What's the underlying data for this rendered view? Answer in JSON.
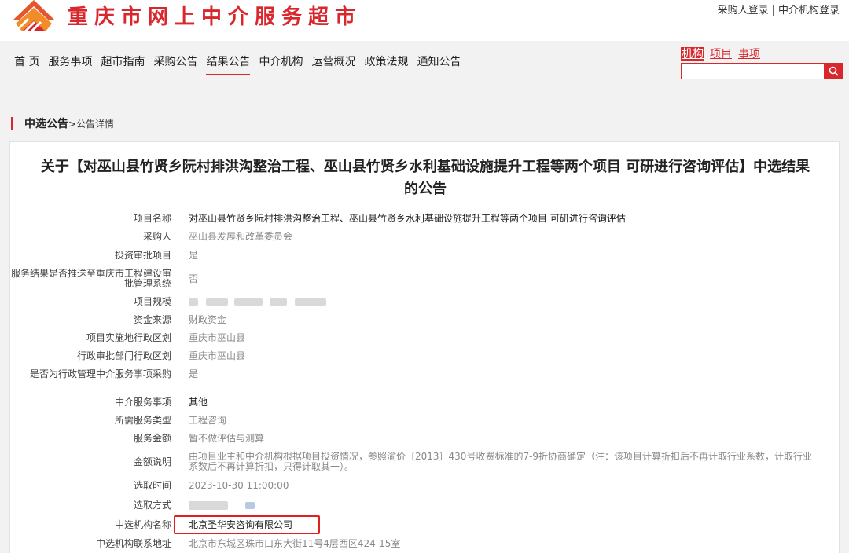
{
  "header": {
    "site_title": "重庆市网上中介服务超市",
    "login_buyer": "采购人登录",
    "login_separator": "|",
    "login_agency": "中介机构登录"
  },
  "nav": {
    "items": [
      {
        "label": "首 页"
      },
      {
        "label": "服务事项"
      },
      {
        "label": "超市指南"
      },
      {
        "label": "采购公告"
      },
      {
        "label": "结果公告",
        "active": true
      },
      {
        "label": "中介机构"
      },
      {
        "label": "运营概况"
      },
      {
        "label": "政策法规"
      },
      {
        "label": "通知公告"
      }
    ]
  },
  "search": {
    "tabs": [
      {
        "label": "机构",
        "active": true
      },
      {
        "label": "项目"
      },
      {
        "label": "事项"
      }
    ],
    "value": "",
    "icon": "search-icon"
  },
  "breadcrumb": {
    "main": "中选公告",
    "sub": ">公告详情"
  },
  "notice": {
    "title_line1": "关于【对巫山县竹贤乡阮村排洪沟整治工程、巫山县竹贤乡水利基础设施提升工程等两个项目 可研进行咨询评估】中选结果",
    "title_line2": "的公告",
    "fields": {
      "project_name": {
        "label": "项目名称",
        "value": "对巫山县竹贤乡阮村排洪沟整治工程、巫山县竹贤乡水利基础设施提升工程等两个项目 可研进行咨询评估"
      },
      "buyer": {
        "label": "采购人",
        "value": "巫山县发展和改革委员会"
      },
      "investment_approval": {
        "label": "投资审批项目",
        "value": "是"
      },
      "push_to_system": {
        "label": "服务结果是否推送至重庆市工程建设审批管理系统",
        "value": "否"
      },
      "project_scale": {
        "label": "项目规模"
      },
      "fund_source": {
        "label": "资金来源",
        "value": "财政资金"
      },
      "impl_region": {
        "label": "项目实施地行政区划",
        "value": "重庆市巫山县"
      },
      "approval_region": {
        "label": "行政审批部门行政区划",
        "value": "重庆市巫山县"
      },
      "admin_purchase": {
        "label": "是否为行政管理中介服务事项采购",
        "value": "是"
      },
      "service_item": {
        "label": "中介服务事项",
        "value": "其他"
      },
      "service_type": {
        "label": "所需服务类型",
        "value": "工程咨询"
      },
      "service_amount": {
        "label": "服务金额",
        "value": "暂不做评估与测算"
      },
      "amount_note": {
        "label": "金额说明",
        "value": "由项目业主和中介机构根据项目投资情况，参照渝价〔2013〕430号收费标准的7-9折协商确定（注：该项目计算折扣后不再计取行业系数，计取行业系数后不再计算折扣，只得计取其一）。"
      },
      "select_time": {
        "label": "选取时间",
        "value": "2023-10-30 11:00:00"
      },
      "select_method": {
        "label": "选取方式"
      },
      "winner_name": {
        "label": "中选机构名称",
        "value": "北京圣华安咨询有限公司"
      },
      "winner_address": {
        "label": "中选机构联系地址",
        "value": "北京市东城区珠市口东大街11号4层西区424-15室"
      }
    }
  },
  "colors": {
    "brand_red": "#d9272e",
    "highlight_red": "#e02020",
    "page_bg": "#f2f2f2"
  }
}
